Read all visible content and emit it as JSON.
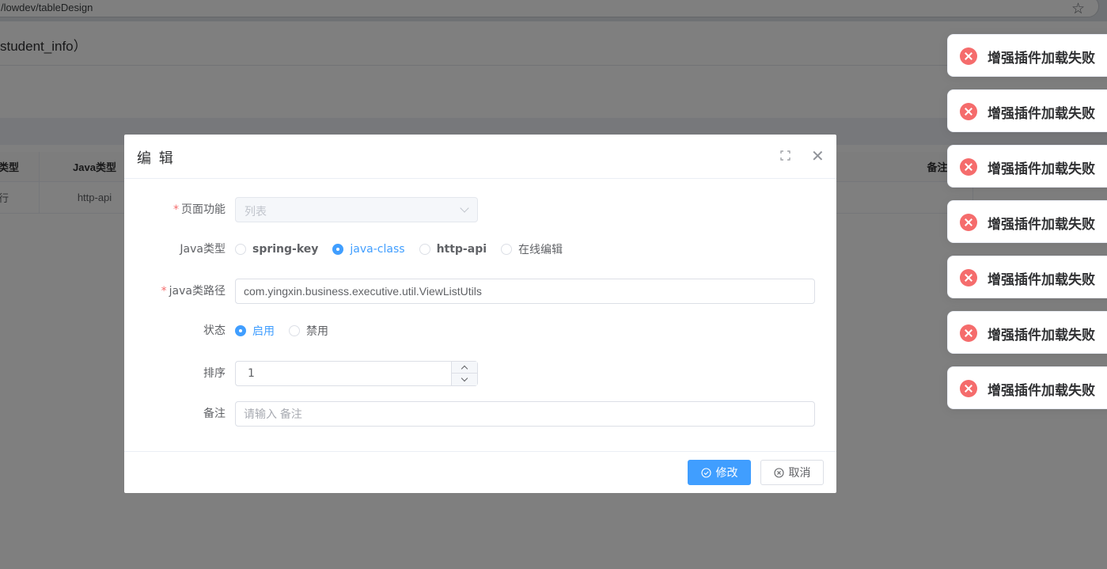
{
  "browser": {
    "url": "/lowdev/tableDesign"
  },
  "background_page": {
    "title": "student_info）",
    "table": {
      "headers": [
        "型类型",
        "Java类型",
        "备注"
      ],
      "row": [
        "行",
        "http-api",
        ""
      ]
    }
  },
  "dialog": {
    "title": "编 辑",
    "fields": {
      "page_function": {
        "label": "页面功能",
        "required": true,
        "value": "列表"
      },
      "java_type": {
        "label": "Java类型",
        "options": [
          "spring-key",
          "java-class",
          "http-api",
          "在线编辑"
        ],
        "selected": "java-class"
      },
      "java_class_path": {
        "label": "java类路径",
        "required": true,
        "value": "com.yingxin.business.executive.util.ViewListUtils"
      },
      "status": {
        "label": "状态",
        "options": [
          "启用",
          "禁用"
        ],
        "selected": "启用"
      },
      "sort": {
        "label": "排序",
        "value": "1"
      },
      "remark": {
        "label": "备注",
        "placeholder": "请输入 备注",
        "value": ""
      }
    },
    "buttons": {
      "submit": "修改",
      "cancel": "取消"
    }
  },
  "notifications": [
    "增强插件加载失败",
    "增强插件加载失败",
    "增强插件加载失败",
    "增强插件加载失败",
    "增强插件加载失败",
    "增强插件加载失败",
    "增强插件加载失败"
  ],
  "colors": {
    "primary": "#409eff",
    "error": "#f56c6c",
    "required_star": "#f56c6c",
    "overlay": "rgba(0,0,0,0.5)"
  }
}
